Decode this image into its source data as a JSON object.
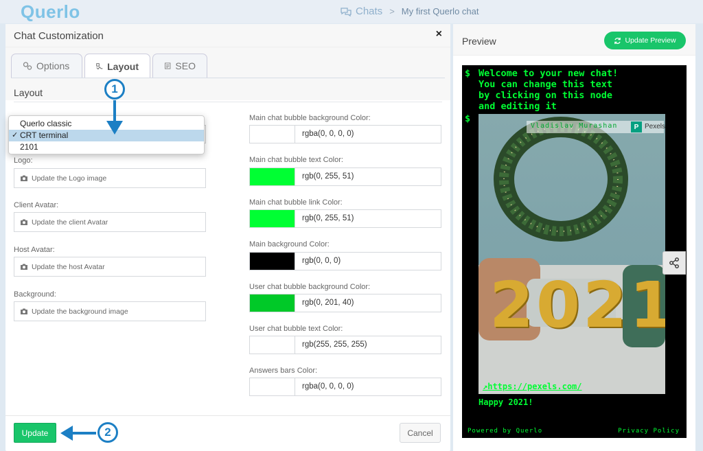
{
  "app": {
    "logo": "Querlo",
    "breadcrumb": {
      "root": "Chats",
      "separator": ">",
      "current": "My first Querlo chat"
    }
  },
  "modal": {
    "title": "Chat Customization",
    "close_label": "×",
    "tabs": [
      {
        "label": "Options",
        "icon": "options-icon",
        "active": false
      },
      {
        "label": "Layout",
        "icon": "layout-icon",
        "active": true
      },
      {
        "label": "SEO",
        "icon": "seo-icon",
        "active": false
      }
    ],
    "section_title": "Layout",
    "theme_select": {
      "options": [
        "Querlo classic",
        "CRT terminal",
        "2101"
      ],
      "selected": "CRT terminal",
      "check": "✓"
    },
    "images": [
      {
        "label": "Logo:",
        "button": "Update the Logo image"
      },
      {
        "label": "Client Avatar:",
        "button": "Update the client Avatar"
      },
      {
        "label": "Host Avatar:",
        "button": "Update the host Avatar"
      },
      {
        "label": "Background:",
        "button": "Update the background image"
      }
    ],
    "colors": [
      {
        "label": "Main chat bubble background Color:",
        "value": "rgba(0, 0, 0, 0)",
        "swatch": "#ffffff"
      },
      {
        "label": "Main chat bubble text Color:",
        "value": "rgb(0, 255, 51)",
        "swatch": "#00ff33"
      },
      {
        "label": "Main chat bubble link Color:",
        "value": "rgb(0, 255, 51)",
        "swatch": "#00ff33"
      },
      {
        "label": "Main background Color:",
        "value": "rgb(0, 0, 0)",
        "swatch": "#000000"
      },
      {
        "label": "User chat bubble background Color:",
        "value": "rgb(0, 201, 40)",
        "swatch": "#00c928"
      },
      {
        "label": "User chat bubble text Color:",
        "value": "rgb(255, 255, 255)",
        "swatch": "#ffffff"
      },
      {
        "label": "Answers bars Color:",
        "value": "rgba(0, 0, 0, 0)",
        "swatch": "#ffffff"
      }
    ],
    "update_label": "Update",
    "cancel_label": "Cancel"
  },
  "annotations": {
    "step1": "1",
    "step2": "2",
    "color": "#1c7fc4"
  },
  "preview": {
    "title": "Preview",
    "update_button": "Update Preview",
    "terminal": {
      "prompt": "$",
      "welcome_lines": [
        "Welcome to your new chat!",
        "You can change this text",
        "by clicking on this node",
        "and editing it"
      ],
      "image_credit": "Vladislav Murashan",
      "pexels_label": "Pexels",
      "pexels_logo": "P",
      "image_text": "2021",
      "link_text": "https://pexels.com/",
      "message": "Happy 2021!",
      "powered_by": "Powered by Querlo",
      "privacy": "Privacy Policy"
    }
  },
  "theme": {
    "accent": "#19c56a",
    "terminal_green": "#00ff33",
    "brand_light": "#7fc3e6"
  }
}
